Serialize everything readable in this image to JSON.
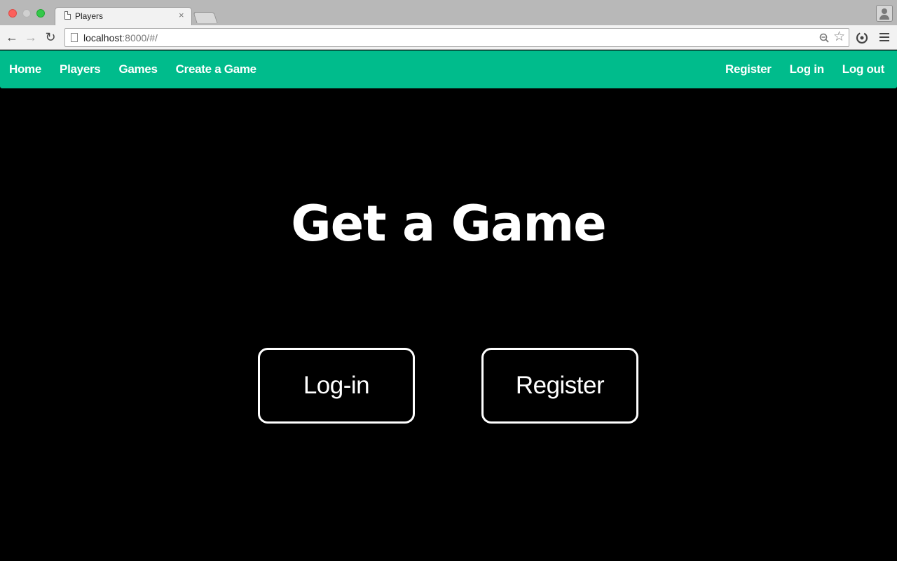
{
  "browser": {
    "tab_title": "Players",
    "tab_close": "×",
    "url_host": "localhost",
    "url_rest": ":8000/#/",
    "icons": [
      "back-arrow-icon",
      "forward-arrow-icon",
      "reload-icon",
      "page-icon",
      "zoom-icon",
      "star-icon",
      "sync-icon",
      "menu-icon",
      "profile-icon"
    ]
  },
  "navbar": {
    "color": "#00bc8c",
    "left_links": [
      "Home",
      "Players",
      "Games",
      "Create a Game"
    ],
    "right_links": [
      "Register",
      "Log in",
      "Log out"
    ]
  },
  "hero": {
    "title": "Get a Game",
    "login_label": "Log-in",
    "register_label": "Register"
  }
}
